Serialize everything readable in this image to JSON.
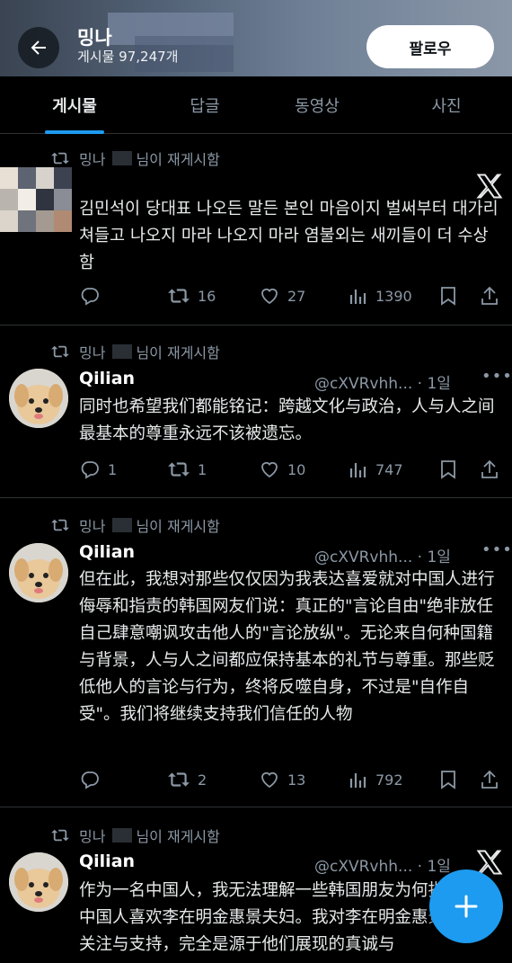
{
  "header": {
    "name": "밍나",
    "post_count": "게시물 97,247개",
    "follow_label": "팔로우"
  },
  "tabs": [
    "게시물",
    "답글",
    "동영상",
    "사진"
  ],
  "posts": [
    {
      "repost_name": "밍나",
      "repost_suffix": "님이 재게시함",
      "author": "",
      "handle": "",
      "text": "김민석이 당대표 나오든 말든 본인 마음이지 벌써부터 대가리 쳐들고 나오지 마라 나오지 마라 염불외는 새끼들이 더 수상함",
      "replies": "",
      "reposts": "16",
      "likes": "27",
      "views": "1390"
    },
    {
      "repost_name": "밍나",
      "repost_suffix": "님이 재게시함",
      "author": "Qilian",
      "handle": "@cXVRvhh... · 1일",
      "text": "同时也希望我们都能铭记：跨越文化与政治，人与人之间最基本的尊重永远不该被遗忘。",
      "replies": "1",
      "reposts": "1",
      "likes": "10",
      "views": "747"
    },
    {
      "repost_name": "밍나",
      "repost_suffix": "님이 재게시함",
      "author": "Qilian",
      "handle": "@cXVRvhh... · 1일",
      "text": "但在此，我想对那些仅仅因为我表达喜爱就对中国人进行侮辱和指责的韩国网友们说：真正的\"言论自由\"绝非放任自己肆意嘲讽攻击他人的\"言论放纵\"。无论来自何种国籍与背景，人与人之间都应保持基本的礼节与尊重。那些贬低他人的言论与行为，终将反噬自身，不过是\"自作自受\"。我们将继续支持我们信任的人物",
      "replies": "",
      "reposts": "2",
      "likes": "13",
      "views": "792"
    },
    {
      "repost_name": "밍나",
      "repost_suffix": "님이 재게시함",
      "author": "Qilian",
      "handle": "@cXVRvhh... · 1일",
      "text": "作为一名中国人，我无法理解一些韩国朋友为何指责我们中国人喜欢李在明金惠景夫妇。我对李在明金惠景夫妇的关注与支持，完全是源于他们展现的真诚与",
      "replies": "",
      "reposts": "",
      "likes": "",
      "views": ""
    }
  ],
  "colors": {
    "background": "#000000",
    "text": "#e7e9ea",
    "muted": "#8b98a5",
    "accent": "#1d9bf0",
    "divider": "#2f3336"
  },
  "icons": [
    "back-arrow-icon",
    "repost-icon",
    "x-logo-icon",
    "reply-icon",
    "like-icon",
    "views-icon",
    "bookmark-icon",
    "share-icon",
    "more-icon",
    "plus-icon"
  ]
}
